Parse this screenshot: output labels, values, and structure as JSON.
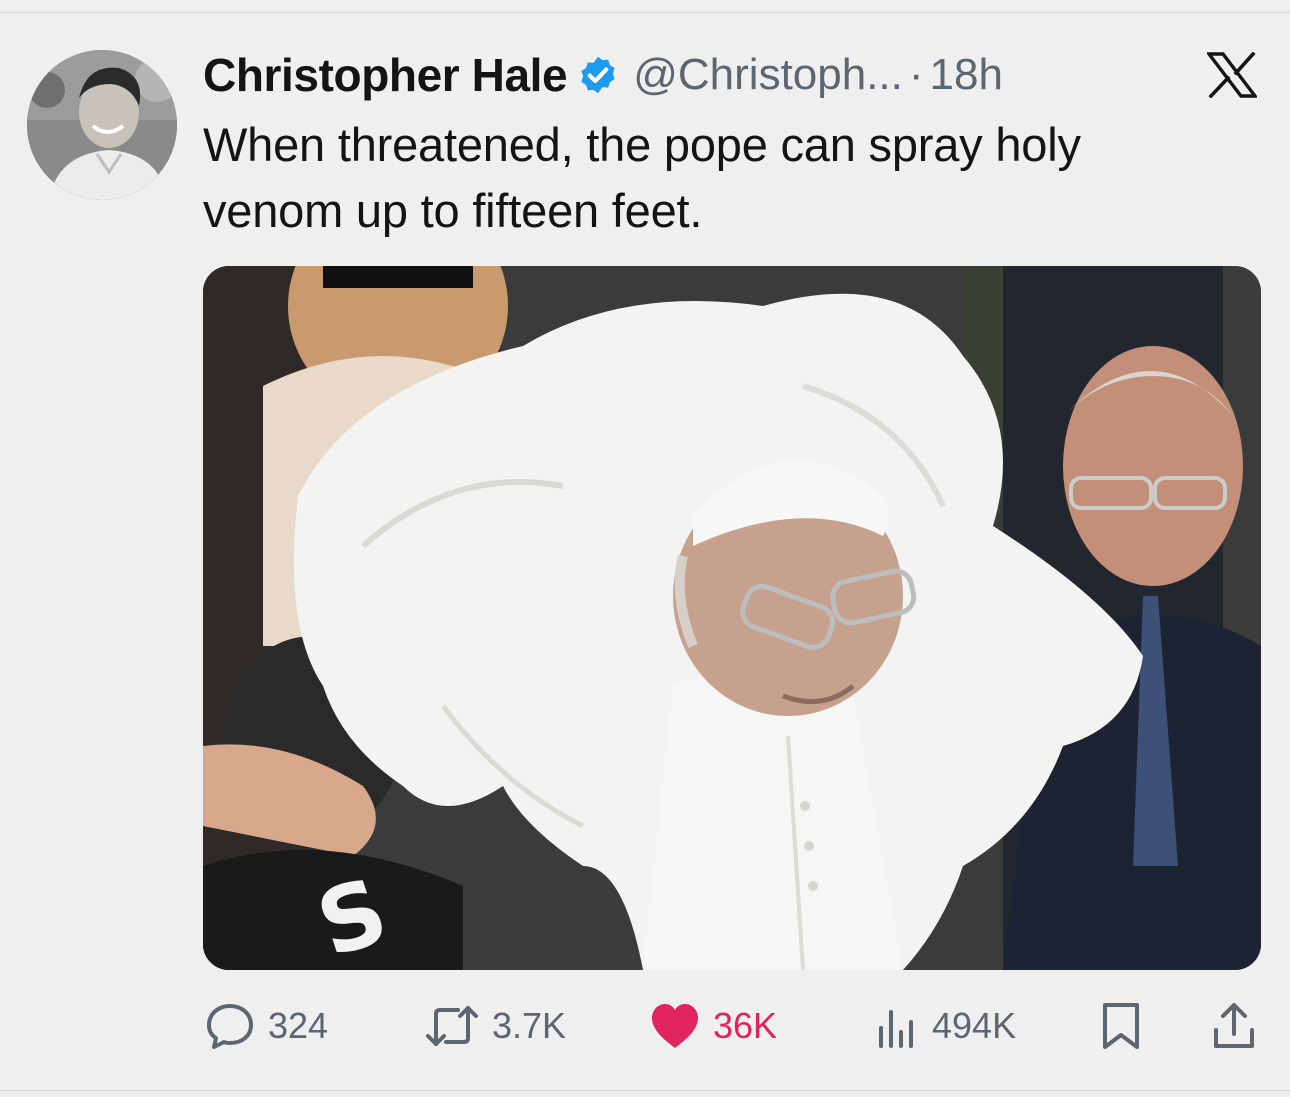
{
  "tweet": {
    "author_name": "Christopher Hale",
    "handle": "@Christoph...",
    "separator": "·",
    "time": "18h",
    "text_lines": [
      "When threatened, the pope can spray holy",
      "venom up to fifteen feet."
    ]
  },
  "metrics": {
    "replies": "324",
    "retweets": "3.7K",
    "likes": "36K",
    "views": "494K"
  },
  "icons": {
    "verified": "verified-badge-icon",
    "platform": "x-logo-icon",
    "reply": "reply-icon",
    "retweet": "retweet-icon",
    "like": "heart-icon",
    "views": "views-icon",
    "bookmark": "bookmark-icon",
    "share": "share-icon"
  },
  "colors": {
    "verified": "#1d9bf0",
    "liked": "#e0245e",
    "muted_text": "#5c6670",
    "background": "#efefef"
  }
}
